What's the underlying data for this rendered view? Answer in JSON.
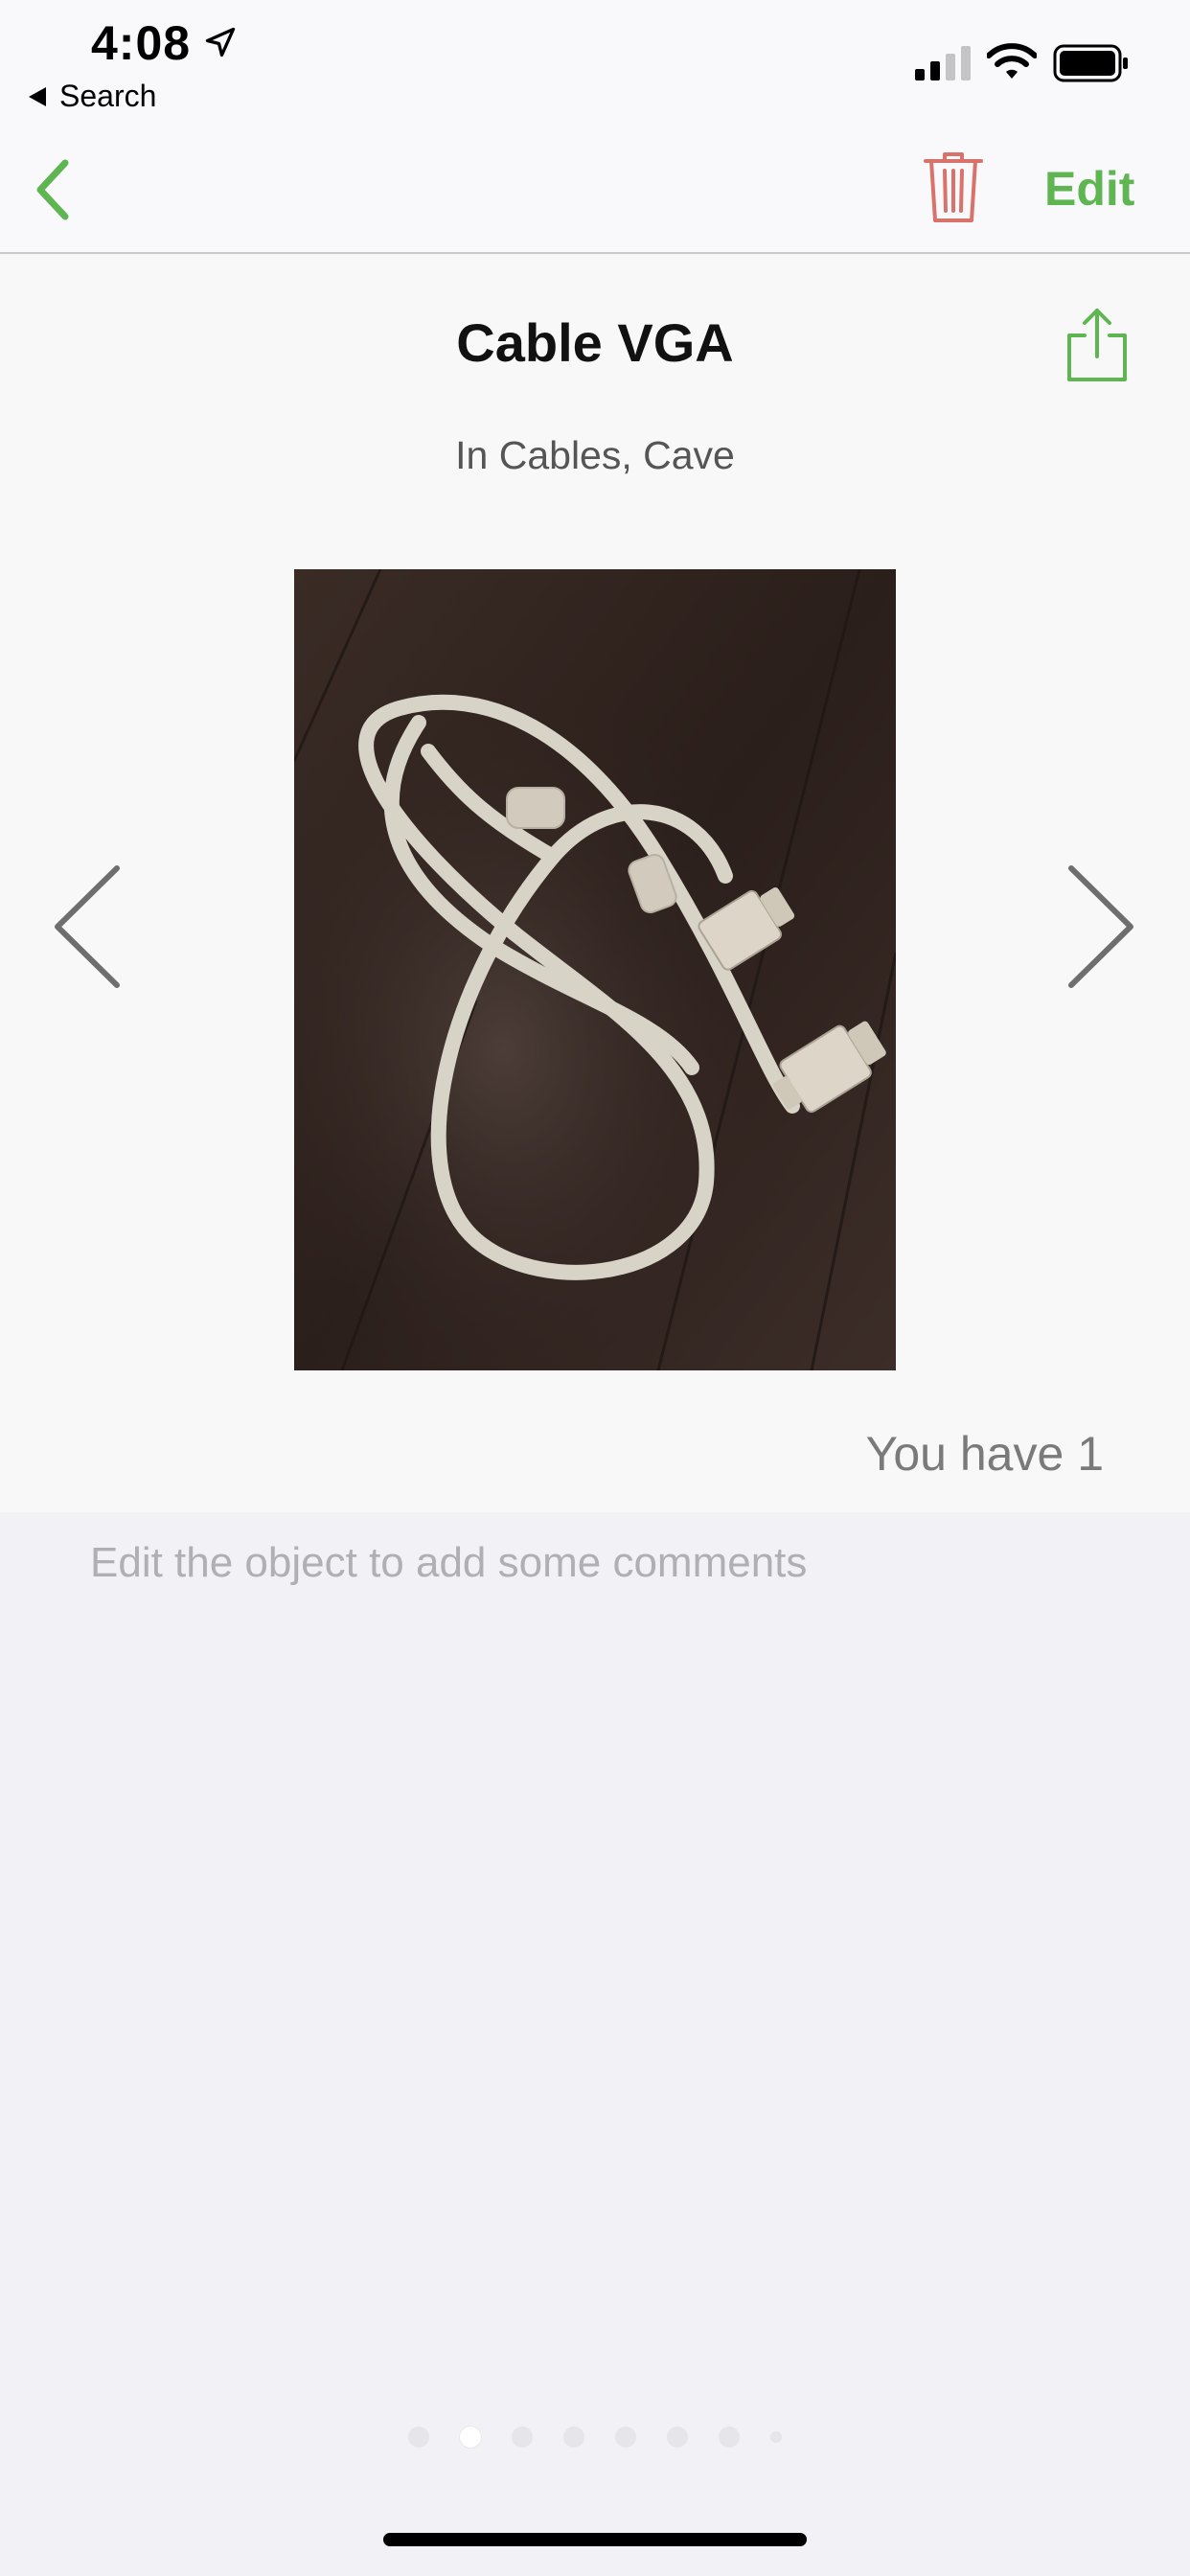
{
  "status_bar": {
    "time": "4:08",
    "back_app_label": "Search",
    "icons": [
      "location-arrow-icon",
      "signal-icon",
      "wifi-icon",
      "battery-icon"
    ]
  },
  "nav": {
    "edit_label": "Edit",
    "icons": [
      "chevron-left-icon",
      "trash-icon"
    ],
    "accent_color": "#5fb552",
    "trash_color": "#d9726b"
  },
  "item": {
    "title": "Cable VGA",
    "location": "In Cables, Cave",
    "quantity_text": "You have 1",
    "photo": "vga-cable-photo"
  },
  "comments": {
    "placeholder": "Edit the object to add some comments"
  },
  "pager": {
    "count": 8,
    "active_index": 1
  }
}
